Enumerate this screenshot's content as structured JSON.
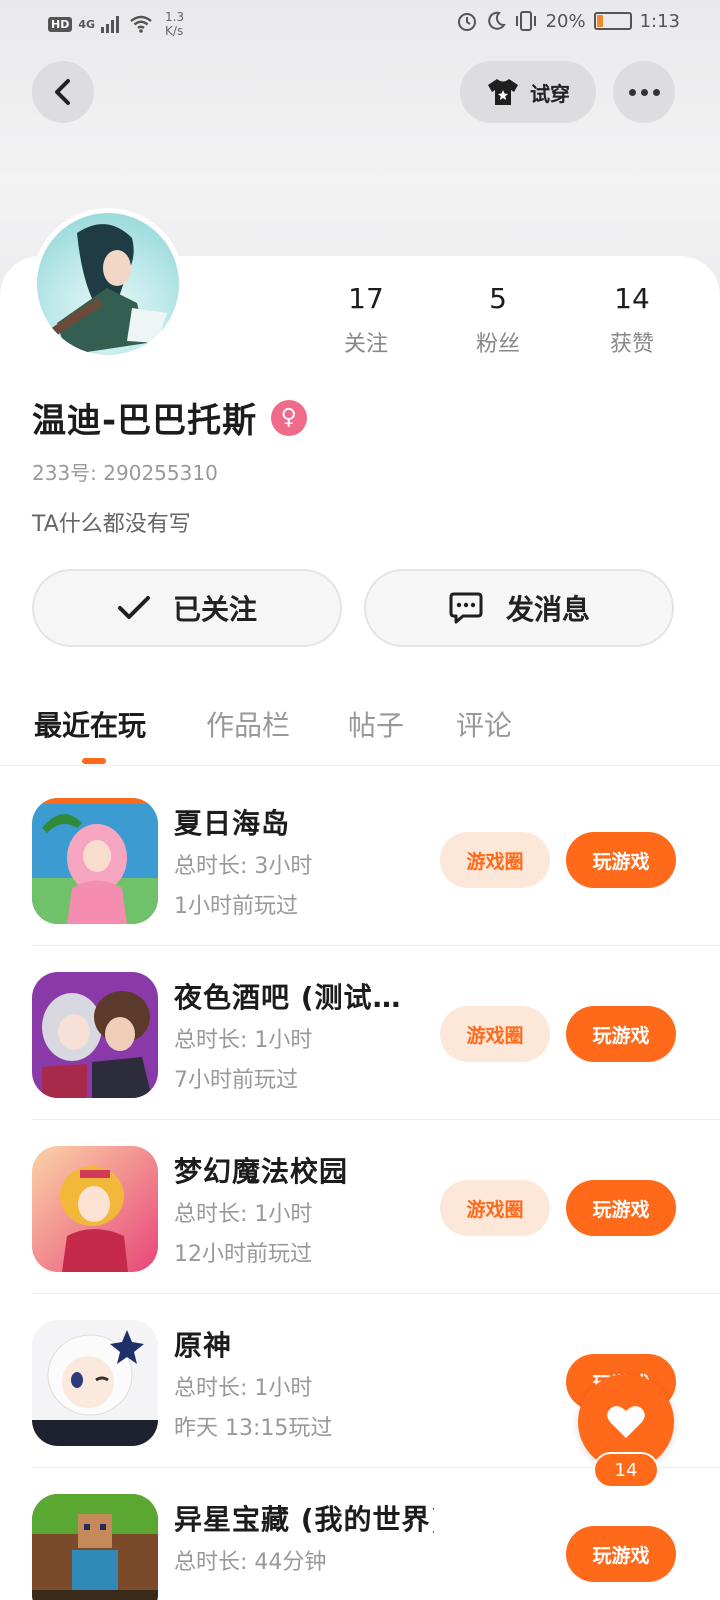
{
  "status_bar": {
    "hd": "HD",
    "signal": "4G",
    "speed_value": "1.3",
    "speed_unit": "K/s",
    "battery_percent": "20%",
    "battery_level": 0.2,
    "time": "1:13"
  },
  "header": {
    "try_on_label": "试穿"
  },
  "profile": {
    "username": "温迪-巴巴托斯",
    "gender_symbol": "♀",
    "uid_label": "233号: ",
    "uid": "290255310",
    "bio": "TA什么都没有写",
    "stats": [
      {
        "value": "17",
        "label": "关注"
      },
      {
        "value": "5",
        "label": "粉丝"
      },
      {
        "value": "14",
        "label": "获赞"
      }
    ],
    "follow_label": "已关注",
    "message_label": "发消息"
  },
  "tabs": [
    {
      "label": "最近在玩",
      "active": true
    },
    {
      "label": "作品栏",
      "active": false
    },
    {
      "label": "帖子",
      "active": false
    },
    {
      "label": "评论",
      "active": false
    }
  ],
  "games": [
    {
      "name": "夏日海岛",
      "duration": "总时长: 3小时",
      "last_played": "1小时前玩过",
      "circle_label": "游戏圈",
      "play_label": "玩游戏",
      "icon_colors": [
        "#f7a6c2",
        "#3c9bd0"
      ]
    },
    {
      "name": "夜色酒吧 (测试…",
      "duration": "总时长: 1小时",
      "last_played": "7小时前玩过",
      "circle_label": "游戏圈",
      "play_label": "玩游戏",
      "icon_colors": [
        "#8a3aa8",
        "#5b3a2b"
      ]
    },
    {
      "name": "梦幻魔法校园",
      "duration": "总时长: 1小时",
      "last_played": "12小时前玩过",
      "circle_label": "游戏圈",
      "play_label": "玩游戏",
      "icon_colors": [
        "#f7c27a",
        "#e8457a"
      ]
    },
    {
      "name": "原神",
      "duration": "总时长: 1小时",
      "last_played": "昨天 13:15玩过",
      "circle_label": "",
      "play_label": "玩游戏",
      "icon_colors": [
        "#f4f4f6",
        "#2a3d7a"
      ]
    },
    {
      "name": "异星宝藏 (我的世界)",
      "duration": "总时长: 44分钟",
      "last_played": "",
      "circle_label": "",
      "play_label": "玩游戏",
      "icon_colors": [
        "#5aa832",
        "#7a4a2a"
      ]
    }
  ],
  "like_fab": {
    "count": "14"
  },
  "colors": {
    "accent": "#ff6a1a",
    "accent_light": "#fde7d9",
    "female_badge": "#f06a8a"
  }
}
